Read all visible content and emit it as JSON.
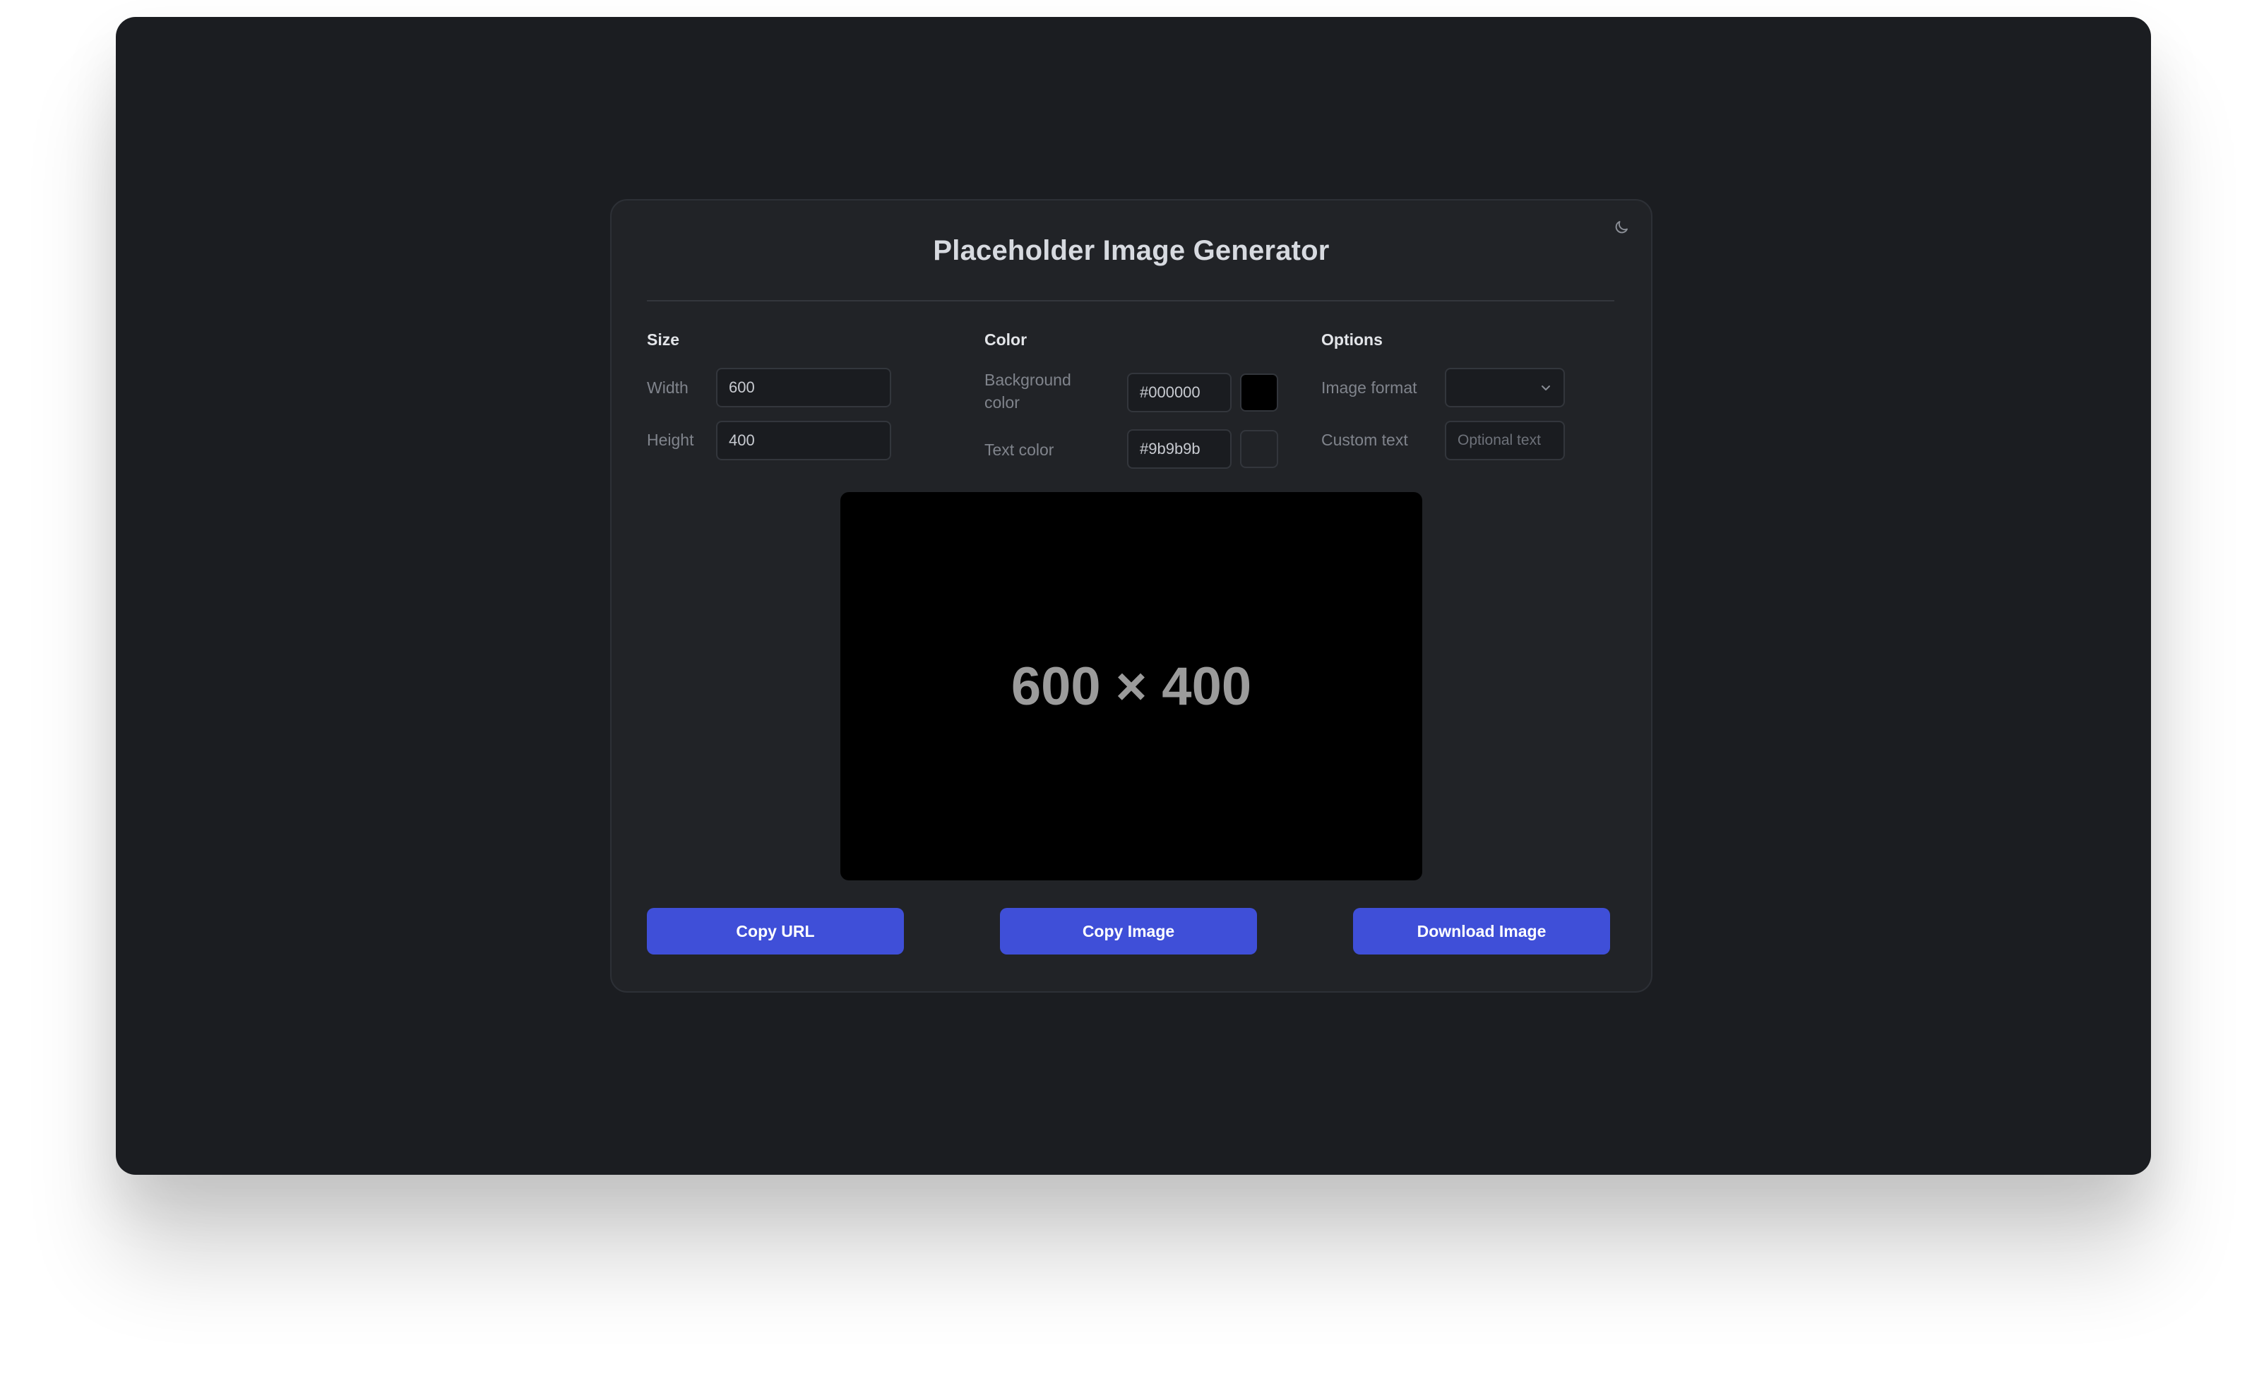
{
  "app": {
    "title": "Placeholder Image Generator",
    "theme_icon": "moon-icon"
  },
  "size": {
    "heading": "Size",
    "width_label": "Width",
    "width_value": "600",
    "height_label": "Height",
    "height_value": "400"
  },
  "color": {
    "heading": "Color",
    "background_label_line1": "Background",
    "background_label_line2": "color",
    "background_value": "#000000",
    "text_label": "Text color",
    "text_value": "#9b9b9b"
  },
  "options": {
    "heading": "Options",
    "format_label": "Image format",
    "format_value": "",
    "format_icon": "chevron-down-icon",
    "custom_text_label": "Custom text",
    "custom_text_placeholder": "Optional text"
  },
  "preview": {
    "text": "600 × 400",
    "background": "#000000",
    "text_color": "#9b9b9b"
  },
  "actions": {
    "copy_url": "Copy URL",
    "copy_image": "Copy Image",
    "download_image": "Download Image"
  },
  "colors": {
    "accent": "#3f4fd8",
    "window_bg": "#1b1d21",
    "card_bg": "#212327"
  }
}
